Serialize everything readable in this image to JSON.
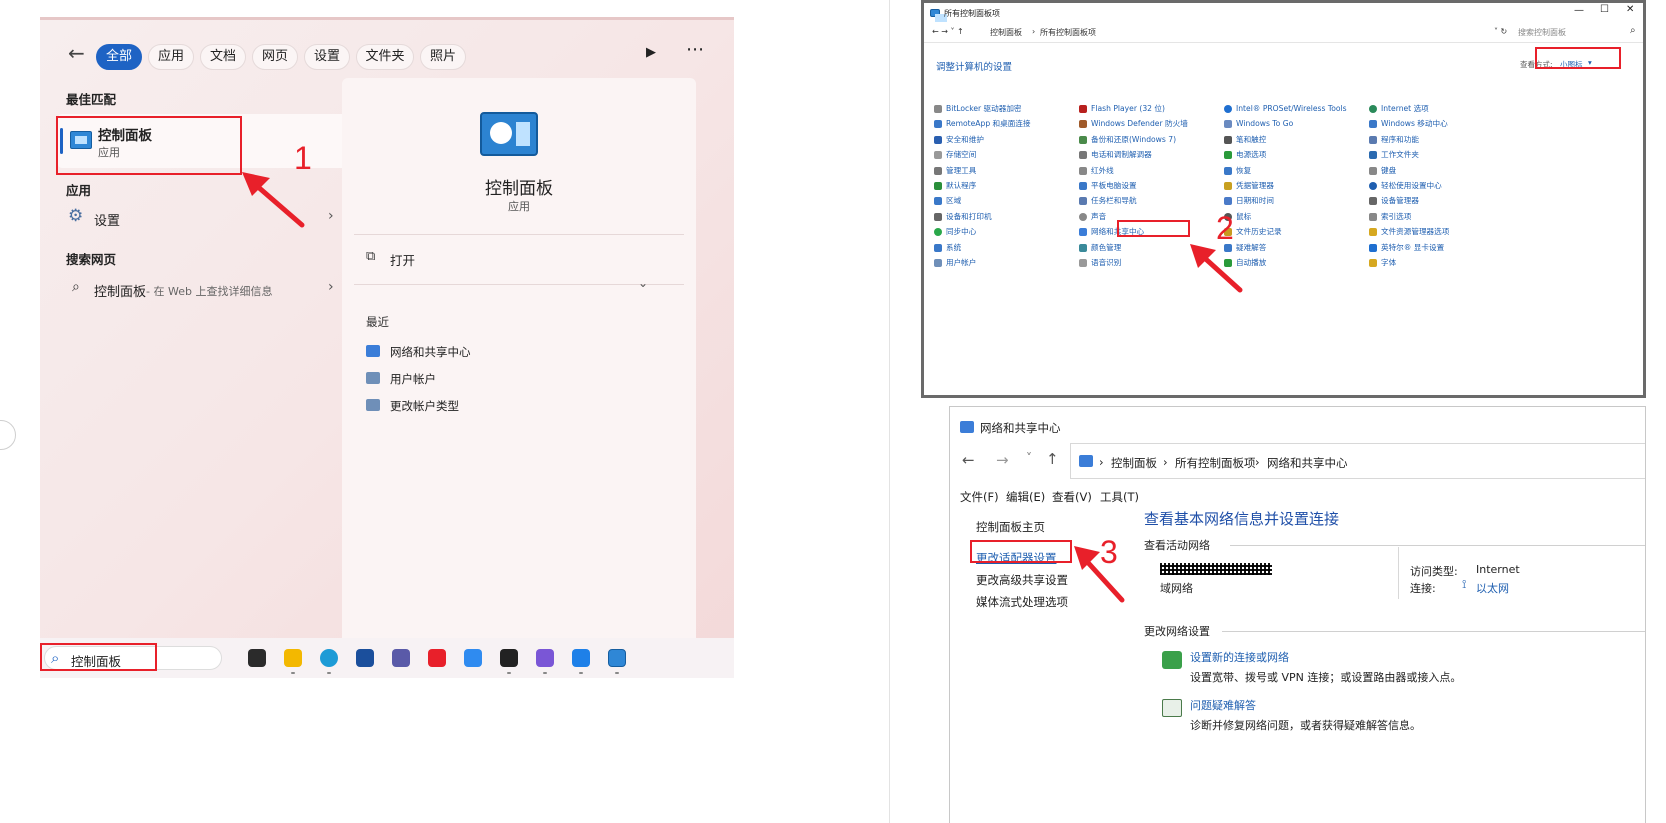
{
  "search": {
    "chips": [
      "全部",
      "应用",
      "文档",
      "网页",
      "设置",
      "文件夹",
      "照片"
    ],
    "best_match_title": "最佳匹配",
    "best_match_name": "控制面板",
    "best_match_type": "应用",
    "apps_title": "应用",
    "apps_item": "设置",
    "web_title": "搜索网页",
    "web_item": "控制面板",
    "web_suffix": " - 在 Web 上查找详细信息",
    "detail_name": "控制面板",
    "detail_type": "应用",
    "open_label": "打开",
    "recent_title": "最近",
    "recent_items": [
      "网络和共享中心",
      "用户帐户",
      "更改帐户类型"
    ],
    "search_box_text": "控制面板"
  },
  "annotations": {
    "step1": "1",
    "step2": "2",
    "step3": "3"
  },
  "control_panel": {
    "window_title": "所有控制面板项",
    "breadcrumb": [
      "控制面板",
      "所有控制面板项"
    ],
    "search_placeholder": "搜索控制面板",
    "heading": "调整计算机的设置",
    "view_label": "查看方式:",
    "view_value": "小图标",
    "columns": [
      [
        "BitLocker 驱动器加密",
        "RemoteApp 和桌面连接",
        "安全和维护",
        "存储空间",
        "管理工具",
        "默认程序",
        "区域",
        "设备和打印机",
        "同步中心",
        "系统",
        "用户帐户"
      ],
      [
        "Flash Player (32 位)",
        "Windows Defender 防火墙",
        "备份和还原(Windows 7)",
        "电话和调制解调器",
        "红外线",
        "平板电脑设置",
        "任务栏和导航",
        "声音",
        "网络和共享中心",
        "颜色管理",
        "语音识别"
      ],
      [
        "Intel® PROSet/Wireless Tools",
        "Windows To Go",
        "笔和触控",
        "电源选项",
        "恢复",
        "凭据管理器",
        "日期和时间",
        "鼠标",
        "文件历史记录",
        "疑难解答",
        "自动播放"
      ],
      [
        "Internet 选项",
        "Windows 移动中心",
        "程序和功能",
        "工作文件夹",
        "键盘",
        "轻松使用设置中心",
        "设备管理器",
        "索引选项",
        "文件资源管理器选项",
        "英特尔® 显卡设置",
        "字体"
      ]
    ]
  },
  "network_center": {
    "window_title": "网络和共享中心",
    "breadcrumb": [
      "控制面板",
      "所有控制面板项",
      "网络和共享中心"
    ],
    "menu": [
      "文件(F)",
      "编辑(E)",
      "查看(V)",
      "工具(T)"
    ],
    "sidebar": [
      "控制面板主页",
      "更改适配器设置",
      "更改高级共享设置",
      "媒体流式处理选项"
    ],
    "title": "查看基本网络信息并设置连接",
    "active_networks": "查看活动网络",
    "network_type": "域网络",
    "access_label": "访问类型:",
    "access_value": "Internet",
    "conn_label": "连接:",
    "conn_value": "以太网",
    "change_settings": "更改网络设置",
    "new_conn_link": "设置新的连接或网络",
    "new_conn_desc": "设置宽带、拨号或 VPN 连接；或设置路由器或接入点。",
    "troubleshoot_link": "问题疑难解答",
    "troubleshoot_desc": "诊断并修复网络问题，或者获得疑难解答信息。"
  }
}
